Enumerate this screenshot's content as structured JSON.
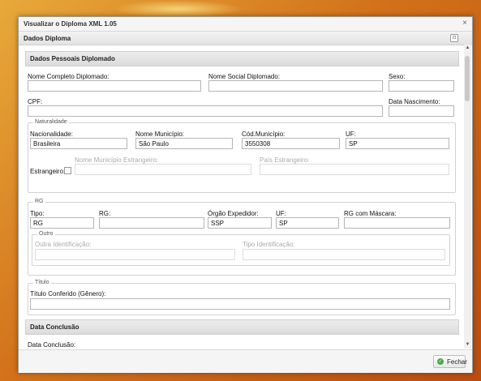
{
  "window": {
    "title": "Visualizar o Diploma XML 1.05",
    "close_icon": "×"
  },
  "panel": {
    "title": "Dados Diploma",
    "tool_icon": "⊡"
  },
  "sections": {
    "pessoais": "Dados Pessoais Diplomado",
    "conclusao": "Data Conclusão"
  },
  "fields": {
    "nome_completo": {
      "label": "Nome Completo Diplomado:",
      "value": ""
    },
    "nome_social": {
      "label": "Nome Social Diplomado:",
      "value": ""
    },
    "sexo": {
      "label": "Sexo:",
      "value": ""
    },
    "cpf": {
      "label": "CPF:",
      "value": ""
    },
    "data_nascimento": {
      "label": "Data Nascimento:",
      "value": ""
    },
    "data_conclusao": {
      "label": "Data Conclusão:",
      "value": ""
    }
  },
  "naturalidade": {
    "legend": "Naturalidade",
    "nacionalidade": {
      "label": "Nacionalidade:",
      "value": "Brasileira"
    },
    "municipio": {
      "label": "Nome Município:",
      "value": "São Paulo"
    },
    "cod_municipio": {
      "label": "Cód.Município:",
      "value": "3550308"
    },
    "uf": {
      "label": "UF:",
      "value": "SP"
    },
    "municipio_estrangeiro": {
      "label": "Nome Município Estrangeiro:",
      "value": ""
    },
    "pais_estrangeiro": {
      "label": "País Estrangeiro:",
      "value": ""
    },
    "estrangeiro": {
      "label": "Estrangeiro:",
      "checked": false
    }
  },
  "rg": {
    "legend": "RG",
    "tipo": {
      "label": "Tipo:",
      "value": "RG"
    },
    "rg": {
      "label": "RG:",
      "value": ""
    },
    "orgao": {
      "label": "Órgão Expedidor:",
      "value": "SSP"
    },
    "uf": {
      "label": "UF:",
      "value": "SP"
    },
    "mascara": {
      "label": "RG com Máscara:",
      "value": ""
    },
    "outro": {
      "legend": "Outro",
      "identificacao": {
        "label": "Outra Identificação:",
        "value": ""
      },
      "tipo": {
        "label": "Tipo Identificação:",
        "value": ""
      }
    }
  },
  "titulo": {
    "legend": "Título",
    "conferido": {
      "label": "Título Conferido (Gênero):",
      "value": ""
    }
  },
  "footer": {
    "close_label": "Fechar"
  }
}
